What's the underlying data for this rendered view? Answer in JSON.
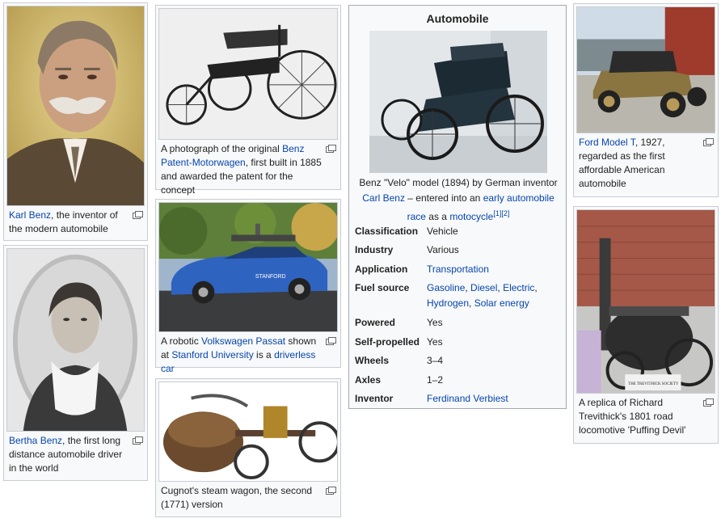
{
  "thumbs": {
    "karl": {
      "name": "Karl Benz",
      "text": ", the inventor of the modern automobile"
    },
    "motorwagen": {
      "pre": "A photograph of the original ",
      "name": "Benz Patent-Motorwagen",
      "post": ", first built in 1885 and awarded the patent for the concept"
    },
    "bertha": {
      "name": "Bertha Benz",
      "text": ", the first long distance automobile driver in the world"
    },
    "passat": {
      "pre": "A robotic ",
      "link1": "Volkswagen Passat",
      "mid1": " shown at ",
      "link2": "Stanford University",
      "mid2": " is a ",
      "link3": "driverless car",
      "plate_text": "STANFORD"
    },
    "cugnot": {
      "text": "Cugnot's steam wagon, the second (1771) version"
    },
    "fordt": {
      "name": "Ford Model T",
      "text": ", 1927, regarded as the first affordable American automobile"
    },
    "trevithick": {
      "text": "A replica of Richard Trevithick's 1801 road locomotive 'Puffing Devil'",
      "sign_text": "THE TREVITHICK SOCIETY"
    }
  },
  "infobox": {
    "title": "Automobile",
    "caption": {
      "pre": "Benz \"Velo\" model (1894) by German inventor ",
      "link1": "Carl Benz",
      "mid1": " – entered into an ",
      "link2": "early automobile race",
      "mid2": " as a ",
      "link3": "motocycle",
      "refs": "[1][2]"
    },
    "rows": [
      {
        "label": "Classification",
        "value": "Vehicle",
        "link": false
      },
      {
        "label": "Industry",
        "value": "Various",
        "link": false
      },
      {
        "label": "Application",
        "value": "Transportation",
        "link": true
      },
      {
        "label": "Fuel source",
        "fuel": true
      },
      {
        "label": "Powered",
        "value": "Yes",
        "link": false
      },
      {
        "label": "Self-propelled",
        "value": "Yes",
        "link": false
      },
      {
        "label": "Wheels",
        "value": "3–4",
        "link": false
      },
      {
        "label": "Axles",
        "value": "1–2",
        "link": false
      },
      {
        "label": "Inventor",
        "value": "Ferdinand Verbiest",
        "link": true
      }
    ],
    "fuel_links": {
      "gasoline": "Gasoline",
      "sep1": ", ",
      "diesel": "Diesel",
      "sep2": ", ",
      "electric": "Electric",
      "sep3": ",",
      "hydrogen": "Hydrogen",
      "sep4": ", ",
      "solar": "Solar energy"
    }
  },
  "colors": {
    "link": "#0645ad",
    "border": "#c8ccd1",
    "infobox_border": "#a2a9b1",
    "bg": "#f8f9fa"
  }
}
